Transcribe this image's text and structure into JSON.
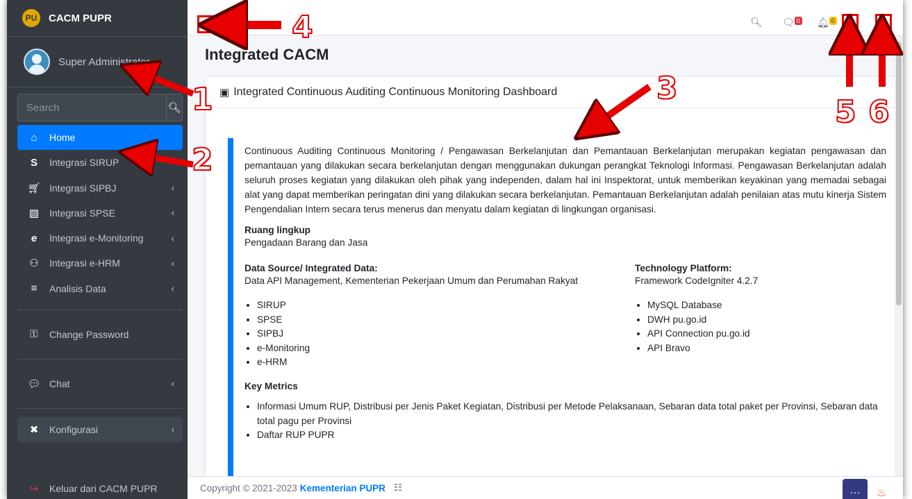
{
  "brand": {
    "logo": "PU",
    "name": "CACM PUPR"
  },
  "user": {
    "name": "Super Administrator"
  },
  "search": {
    "placeholder": "Search"
  },
  "nav": {
    "home": "Home",
    "sirup": "Integrasi SIRUP",
    "sipbj": "Integrasi SIPBJ",
    "spse": "Integrasi SPSE",
    "emon": "Integrasi e-Monitoring",
    "ehrm": "Integrasi e-HRM",
    "analisis": "Analisis Data",
    "change_password": "Change Password",
    "chat": "Chat",
    "konfigurasi": "Konfigurasi",
    "logout": "Keluar dari CACM PUPR"
  },
  "topbar": {
    "messages_count": "0",
    "notifications_count": "0"
  },
  "page": {
    "title": "Integrated CACM"
  },
  "card": {
    "header": "Integrated Continuous Auditing Continuous Monitoring Dashboard",
    "intro": "Continuous Auditing Continuous Monitoring / Pengawasan Berkelanjutan dan Pemantauan Berkelanjutan merupakan kegiatan pengawasan dan pemantauan yang dilakukan secara berkelanjutan dengan menggunakan dukungan perangkat Teknologi Informasi. Pengawasan Berkelanjutan adalah seluruh proses kegiatan yang dilakukan oleh pihak yang independen, dalam hal ini Inspektorat, untuk memberikan keyakinan yang memadai sebagai alat yang dapat memberikan peringatan dini yang dilakukan secara berkelanjutan. Pemantauan Berkelanjutan adalah penilaian atas mutu kinerja Sistem Pengendalian Intern secara terus menerus dan menyatu dalam kegiatan di lingkungan organisasi.",
    "scope_heading": "Ruang lingkup",
    "scope": "Pengadaan Barang dan Jasa",
    "data_source_heading": "Data Source/ Integrated Data:",
    "data_source": "Data API Management, Kementerian Pekerjaan Umum dan Perumahan Rakyat",
    "data_source_items": [
      "SIRUP",
      "SPSE",
      "SIPBJ",
      "e-Monitoring",
      "e-HRM"
    ],
    "tech_heading": "Technology Platform:",
    "tech": "Framework CodeIgniter 4.2.7",
    "tech_items": [
      "MySQL Database",
      "DWH pu.go.id",
      "API Connection pu.go.id",
      "API Bravo"
    ],
    "metrics_heading": "Key Metrics",
    "metrics_items": [
      "Informasi Umum RUP, Distribusi per Jenis Paket Kegiatan, Distribusi per Metode Pelaksanaan, Sebaran data total paket per Provinsi, Sebaran data total pagu per Provinsi",
      "Daftar RUP PUPR"
    ]
  },
  "footer": {
    "text": "Copyright © 2021-2023",
    "link": "Kementerian PUPR"
  },
  "annotations": [
    "1",
    "2",
    "3",
    "4",
    "5",
    "6"
  ]
}
